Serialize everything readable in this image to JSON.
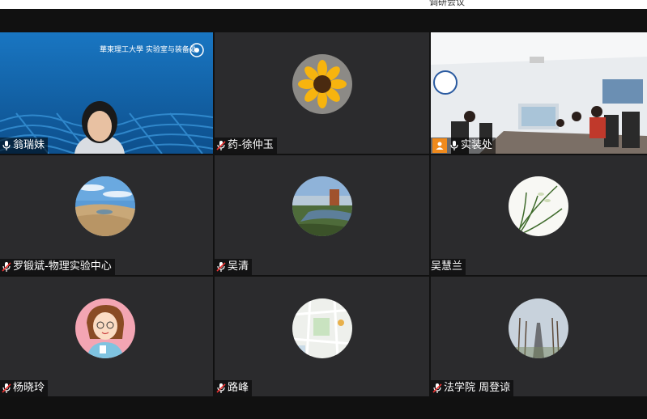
{
  "window": {
    "title": "调研会议"
  },
  "participants": [
    {
      "name": "翁瑞妹",
      "type": "video-slide",
      "mic": "on",
      "banner": "華東理工大學 实验室与装备处"
    },
    {
      "name": "药-徐仲玉",
      "type": "avatar",
      "avatar": "sunflower",
      "mic": "muted"
    },
    {
      "name": "实装处",
      "type": "video-room",
      "mic": "on",
      "active": true
    },
    {
      "name": "罗锻斌-物理实验中心",
      "type": "avatar",
      "avatar": "desert",
      "mic": "muted"
    },
    {
      "name": "吴清",
      "type": "avatar",
      "avatar": "landscape",
      "mic": "muted"
    },
    {
      "name": "吴慧兰",
      "type": "avatar",
      "avatar": "orchid",
      "mic": "none"
    },
    {
      "name": "杨晓玲",
      "type": "avatar",
      "avatar": "cartoon-girl",
      "mic": "muted"
    },
    {
      "name": "路峰",
      "type": "avatar",
      "avatar": "map",
      "mic": "muted"
    },
    {
      "name": "法学院 周登谅",
      "type": "avatar",
      "avatar": "road",
      "mic": "muted"
    }
  ],
  "colors": {
    "active_border": "#35c15a",
    "tile_bg": "#2b2b2d",
    "badge": "#f08a1c"
  }
}
